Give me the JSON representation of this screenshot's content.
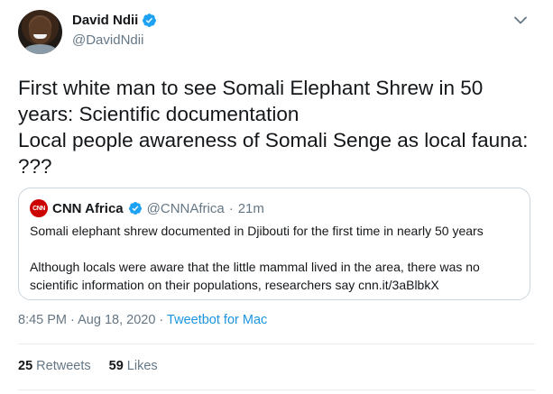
{
  "author": {
    "name": "David Ndii",
    "handle": "@DavidNdii",
    "verified_icon": "verified-badge-icon"
  },
  "tweet_text": "First white man to see Somali Elephant Shrew in 50 years: Scientific documentation\nLocal people awareness of Somali Senge as local fauna: ???",
  "quoted_tweet": {
    "logo_text": "CNN",
    "name": "CNN Africa",
    "handle": "@CNNAfrica",
    "separator": "·",
    "time": "21m",
    "line1": "Somali elephant shrew documented in Djibouti for the first time in nearly 50 years",
    "line2": "Although locals were aware that the little mammal lived in the area, there was no scientific information on their populations, researchers say cnn.it/3aBlbkX"
  },
  "meta": {
    "time": "8:45 PM",
    "sep1": "·",
    "date": "Aug 18, 2020",
    "sep2": "·",
    "source": "Tweetbot for Mac"
  },
  "stats": {
    "retweets_count": "25",
    "retweets_label": "Retweets",
    "likes_count": "59",
    "likes_label": "Likes"
  },
  "colors": {
    "verified": "#1da1f2",
    "link": "#1b95e0",
    "muted": "#657786",
    "cnn_red": "#cc0000"
  }
}
